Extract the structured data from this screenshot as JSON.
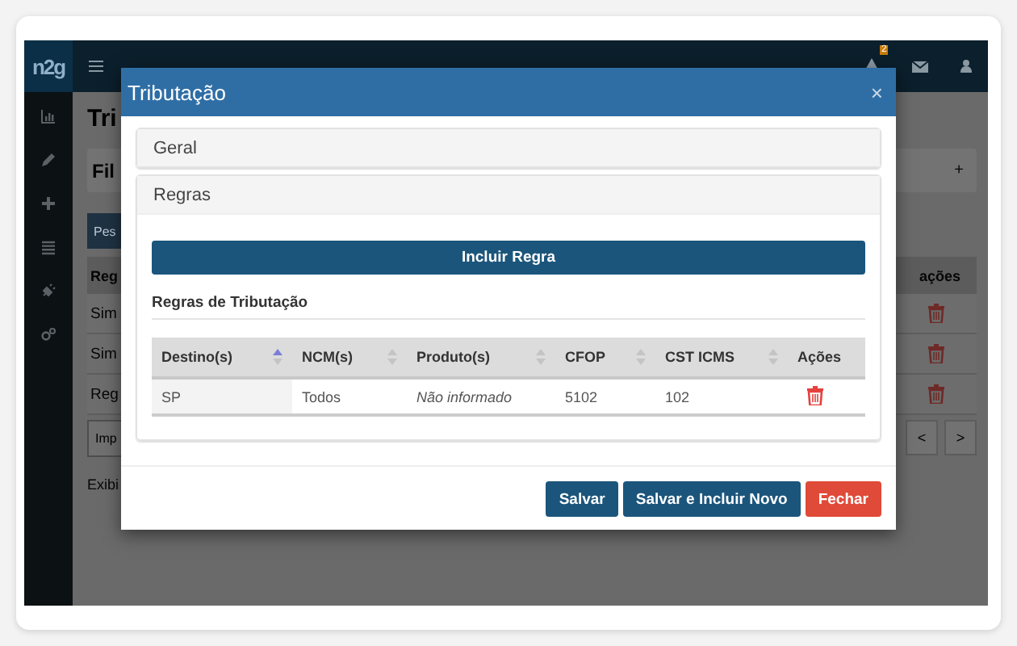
{
  "app": {
    "logo": "n2g",
    "notification_count": "2"
  },
  "background": {
    "page_title": "Tri",
    "filter_panel": {
      "title": "Fil",
      "add": "+"
    },
    "search_button": "Pes",
    "table": {
      "header_left": "Reg",
      "header_right": "ações",
      "rows": [
        "Sim",
        "Sim",
        "Reg"
      ]
    },
    "import_button": "Imp",
    "pagination": [
      "<",
      ">"
    ],
    "footer_text": "Exibi"
  },
  "modal": {
    "title": "Tributação",
    "close": "×",
    "sections": [
      {
        "title": "Geral",
        "expanded": false
      },
      {
        "title": "Regras",
        "expanded": true
      }
    ],
    "add_rule_button": "Incluir Regra",
    "rules_title": "Regras de Tributação",
    "table": {
      "columns": [
        {
          "label": "Destino(s)",
          "sorted": true
        },
        {
          "label": "NCM(s)",
          "sorted": false
        },
        {
          "label": "Produto(s)",
          "sorted": false
        },
        {
          "label": "CFOP",
          "sorted": false
        },
        {
          "label": "CST ICMS",
          "sorted": false
        },
        {
          "label": "Ações"
        }
      ],
      "rows": [
        {
          "cells": [
            "SP",
            "Todos",
            "Não informado",
            "5102",
            "102"
          ]
        }
      ]
    },
    "buttons": [
      {
        "label": "Salvar",
        "kind": "primary"
      },
      {
        "label": "Salvar e Incluir Novo",
        "kind": "primary"
      },
      {
        "label": "Fechar",
        "kind": "danger"
      }
    ]
  }
}
